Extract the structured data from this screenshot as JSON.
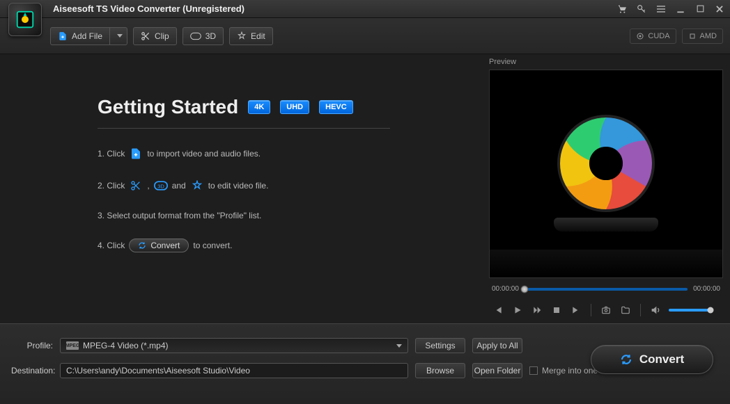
{
  "app": {
    "title": "Aiseesoft TS Video Converter (Unregistered)"
  },
  "toolbar": {
    "add_file": "Add File",
    "clip": "Clip",
    "three_d": "3D",
    "edit": "Edit",
    "cuda": "CUDA",
    "amd": "AMD"
  },
  "getting_started": {
    "title": "Getting Started",
    "badges": {
      "b1": "4K",
      "b2": "UHD",
      "b3": "HEVC"
    },
    "step1a": "1. Click",
    "step1b": "to import video and audio files.",
    "step2a": "2. Click",
    "step2comma": ",",
    "step2and": "and",
    "step2b": "to edit video file.",
    "step3": "3. Select output format from the \"Profile\" list.",
    "step4a": "4. Click",
    "step4convert": "Convert",
    "step4b": "to convert."
  },
  "preview": {
    "label": "Preview",
    "time_start": "00:00:00",
    "time_end": "00:00:00"
  },
  "bottom": {
    "profile_label": "Profile:",
    "profile_value": "MPEG-4 Video (*.mp4)",
    "settings": "Settings",
    "apply_all": "Apply to All",
    "dest_label": "Destination:",
    "dest_value": "C:\\Users\\andy\\Documents\\Aiseesoft Studio\\Video",
    "browse": "Browse",
    "open_folder": "Open Folder",
    "merge": "Merge into one file",
    "convert": "Convert"
  }
}
